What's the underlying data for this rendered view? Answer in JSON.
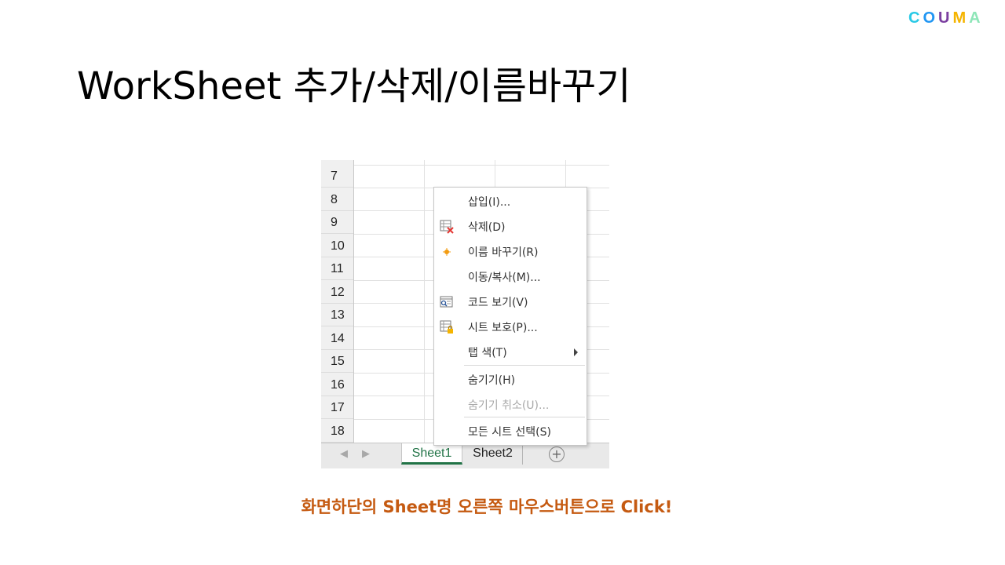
{
  "logo": {
    "letters": [
      {
        "text": "C",
        "color": "#29c9e6"
      },
      {
        "text": "O",
        "color": "#2196f3"
      },
      {
        "text": "U",
        "color": "#7b3fa0"
      },
      {
        "text": "M",
        "color": "#f5b400"
      },
      {
        "text": "A",
        "color": "#8ee6b8"
      }
    ]
  },
  "title": "WorkSheet 추가/삭제/이름바꾸기",
  "spreadsheet": {
    "row_numbers": [
      "7",
      "8",
      "9",
      "10",
      "11",
      "12",
      "13",
      "14",
      "15",
      "16",
      "17",
      "18"
    ],
    "nav_prev": "◀",
    "nav_next": "▶",
    "tabs": [
      "Sheet1",
      "Sheet2"
    ],
    "active_tab": "Sheet1",
    "add_sheet_symbol": "+",
    "accent_color": "#217346"
  },
  "context_menu": {
    "items": [
      {
        "label": "삽입(I)...",
        "icon": null,
        "enabled": true
      },
      {
        "label": "삭제(D)",
        "icon": "delete-sheet-icon",
        "enabled": true
      },
      {
        "label": "이름 바꾸기(R)",
        "icon": "rename-icon",
        "enabled": true
      },
      {
        "label": "이동/복사(M)...",
        "icon": null,
        "enabled": true
      },
      {
        "label": "코드 보기(V)",
        "icon": "view-code-icon",
        "enabled": true
      },
      {
        "label": "시트 보호(P)...",
        "icon": "protect-sheet-icon",
        "enabled": true
      },
      {
        "label": "탭 색(T)",
        "icon": null,
        "enabled": true,
        "submenu": true
      },
      {
        "label": "숨기기(H)",
        "icon": null,
        "enabled": true
      },
      {
        "label": "숨기기 취소(U)...",
        "icon": null,
        "enabled": false
      },
      {
        "label": "모든 시트 선택(S)",
        "icon": null,
        "enabled": true
      }
    ]
  },
  "caption": "화면하단의 Sheet명 오른쪽 마우스버튼으로 Click!"
}
